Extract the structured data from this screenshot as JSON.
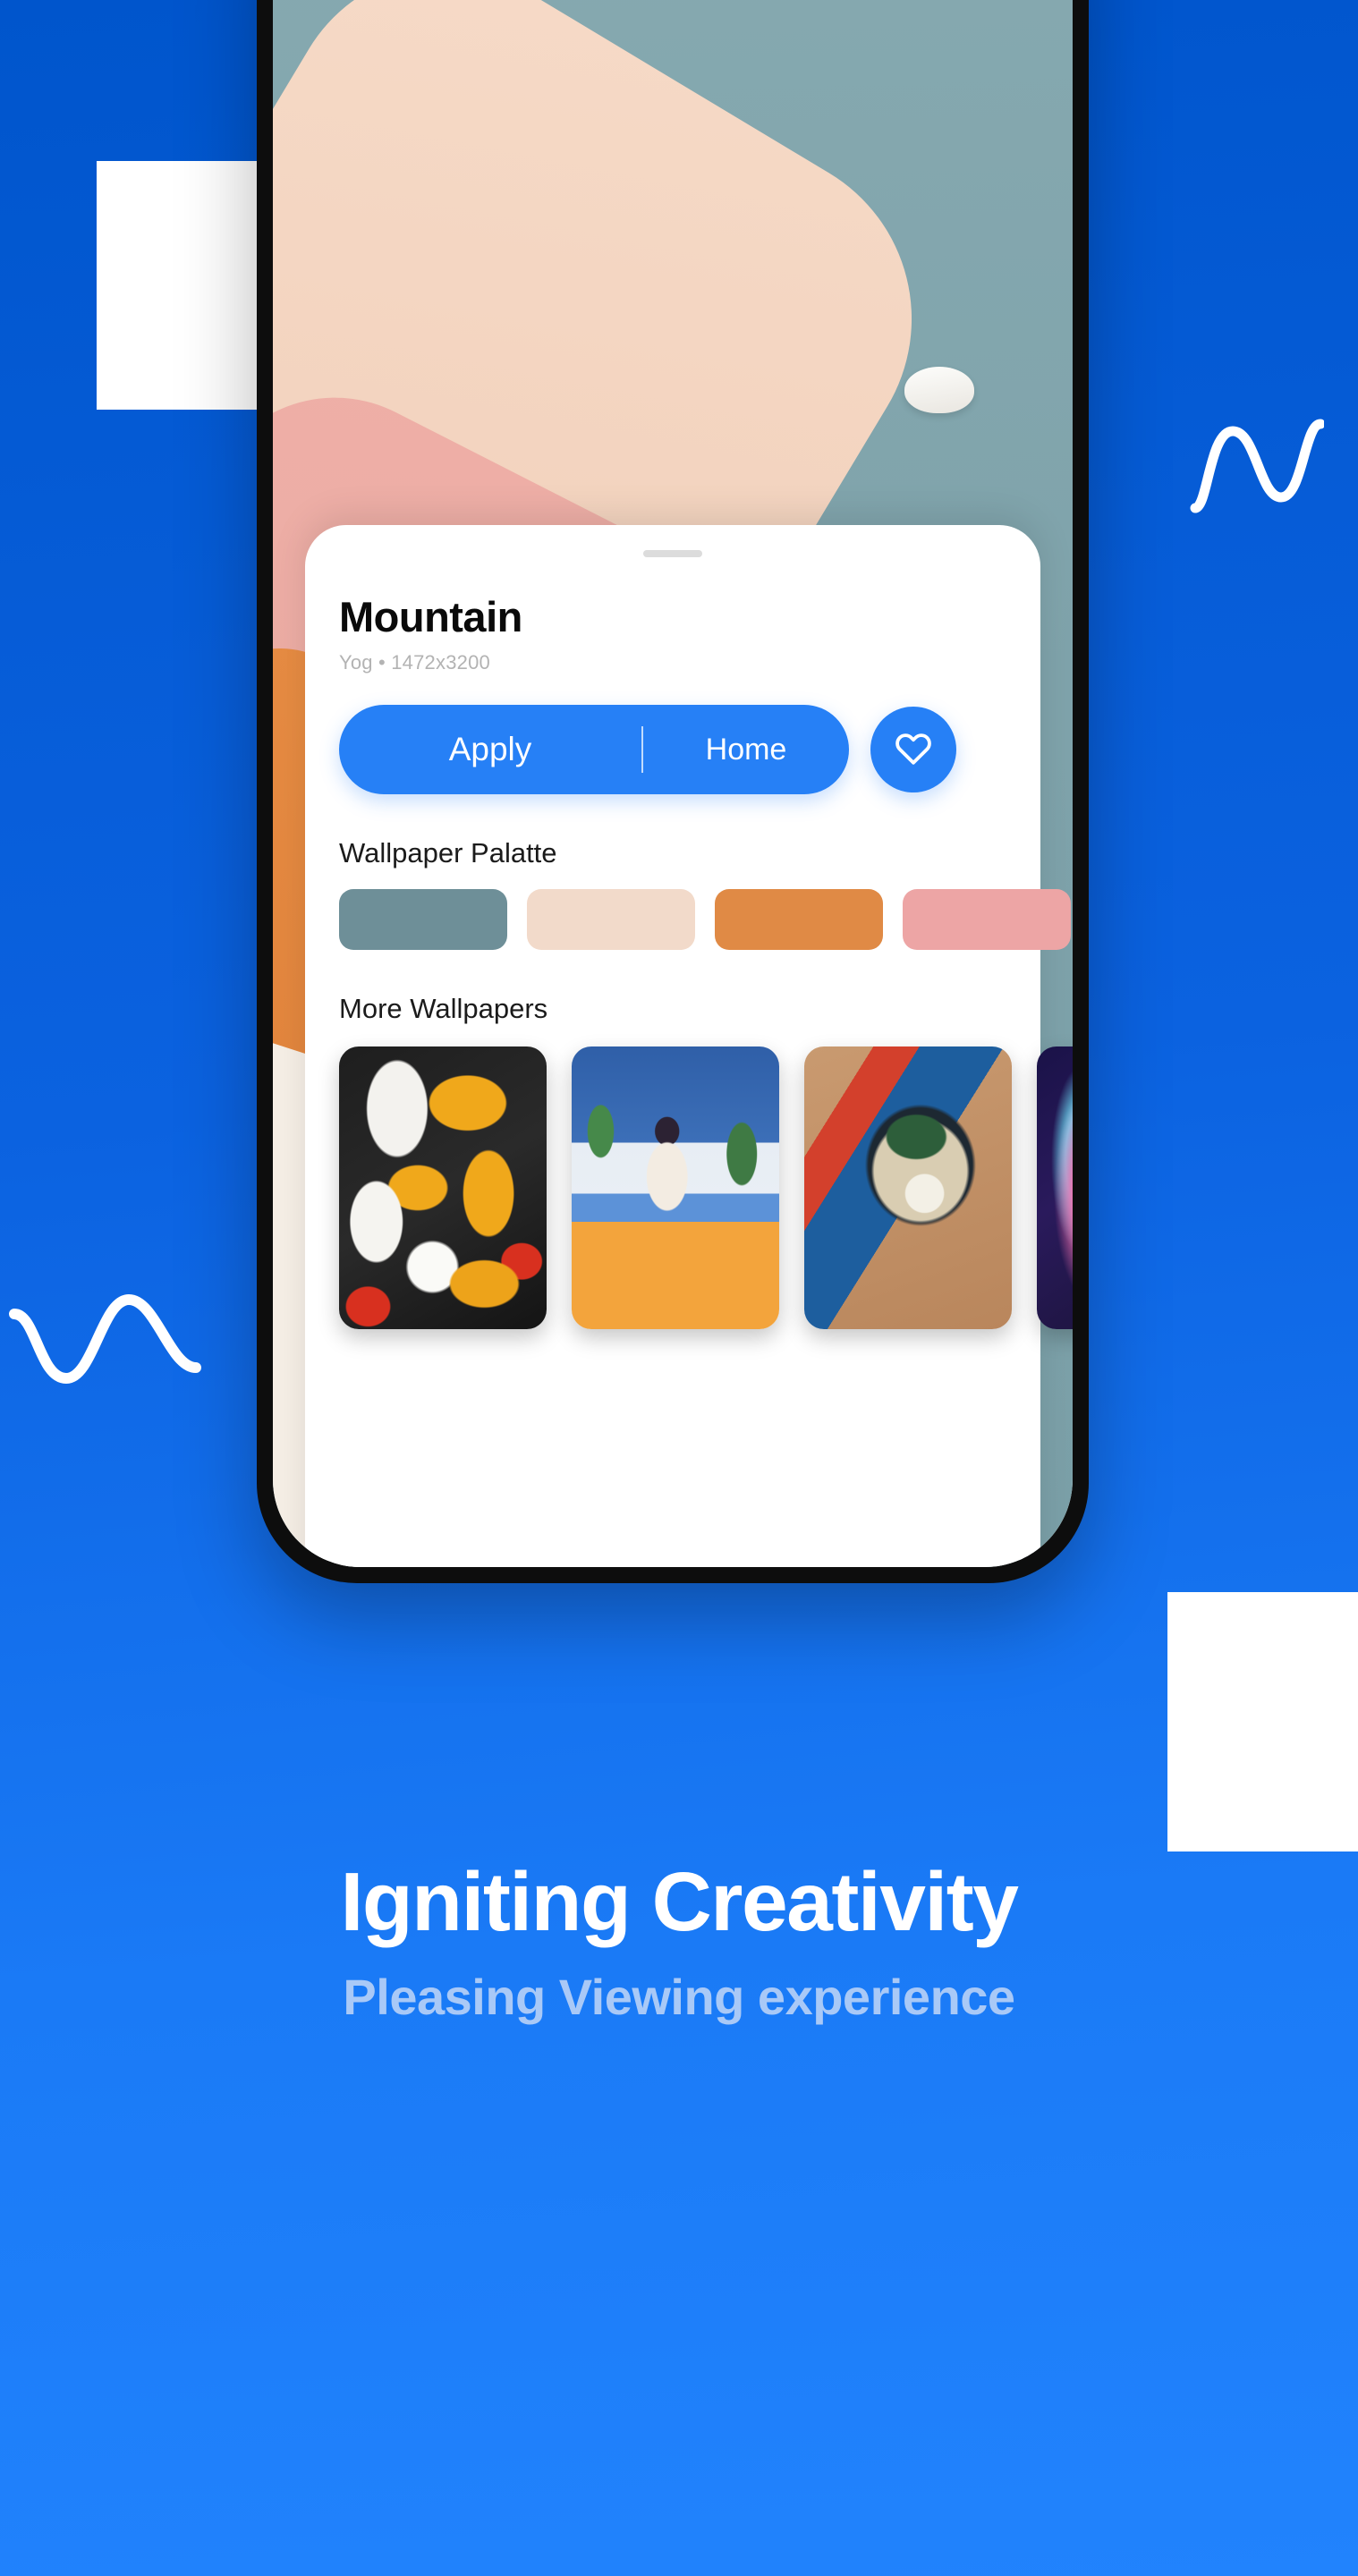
{
  "background": {
    "gradient_top": "#0055CC",
    "gradient_bottom": "#2183FD",
    "accent_blue": "#2680F6"
  },
  "phone": {
    "wallpaper": {
      "name": "minimal-mountain-artwork",
      "sky_color": "#7FA3AB",
      "layers": [
        "#F4D5C0",
        "#EAA79E",
        "#E2802F",
        "#F6EFE6"
      ],
      "stone": "#FBFAF7"
    }
  },
  "sheet": {
    "handle": "drag-handle",
    "title": "Mountain",
    "meta": "Yog • 1472x3200",
    "actions": {
      "apply_label": "Apply",
      "home_label": "Home",
      "favorite_icon": "heart-icon"
    },
    "palette": {
      "title": "Wallpaper Palatte",
      "swatches": [
        {
          "name": "swatch-slate",
          "color": "#6E8F98"
        },
        {
          "name": "swatch-peach",
          "color": "#F2DACA"
        },
        {
          "name": "swatch-orange",
          "color": "#E08A45"
        },
        {
          "name": "swatch-pink",
          "color": "#EDA5A5"
        }
      ]
    },
    "more": {
      "title": "More Wallpapers",
      "thumbnails": [
        {
          "name": "thumb-abstract-graffiti",
          "art": "art-graffiti"
        },
        {
          "name": "thumb-kitchen-illustration",
          "art": "art-kitchen"
        },
        {
          "name": "thumb-ramen-bowl",
          "art": "art-ramen"
        },
        {
          "name": "thumb-liquid-abstract",
          "art": "art-liquid"
        },
        {
          "name": "thumb-ember-dark",
          "art": "art-ember"
        }
      ]
    }
  },
  "copy": {
    "headline": "Igniting Creativity",
    "subheadline": "Pleasing Viewing experience",
    "subheadline_color": "#A9C9F7"
  }
}
